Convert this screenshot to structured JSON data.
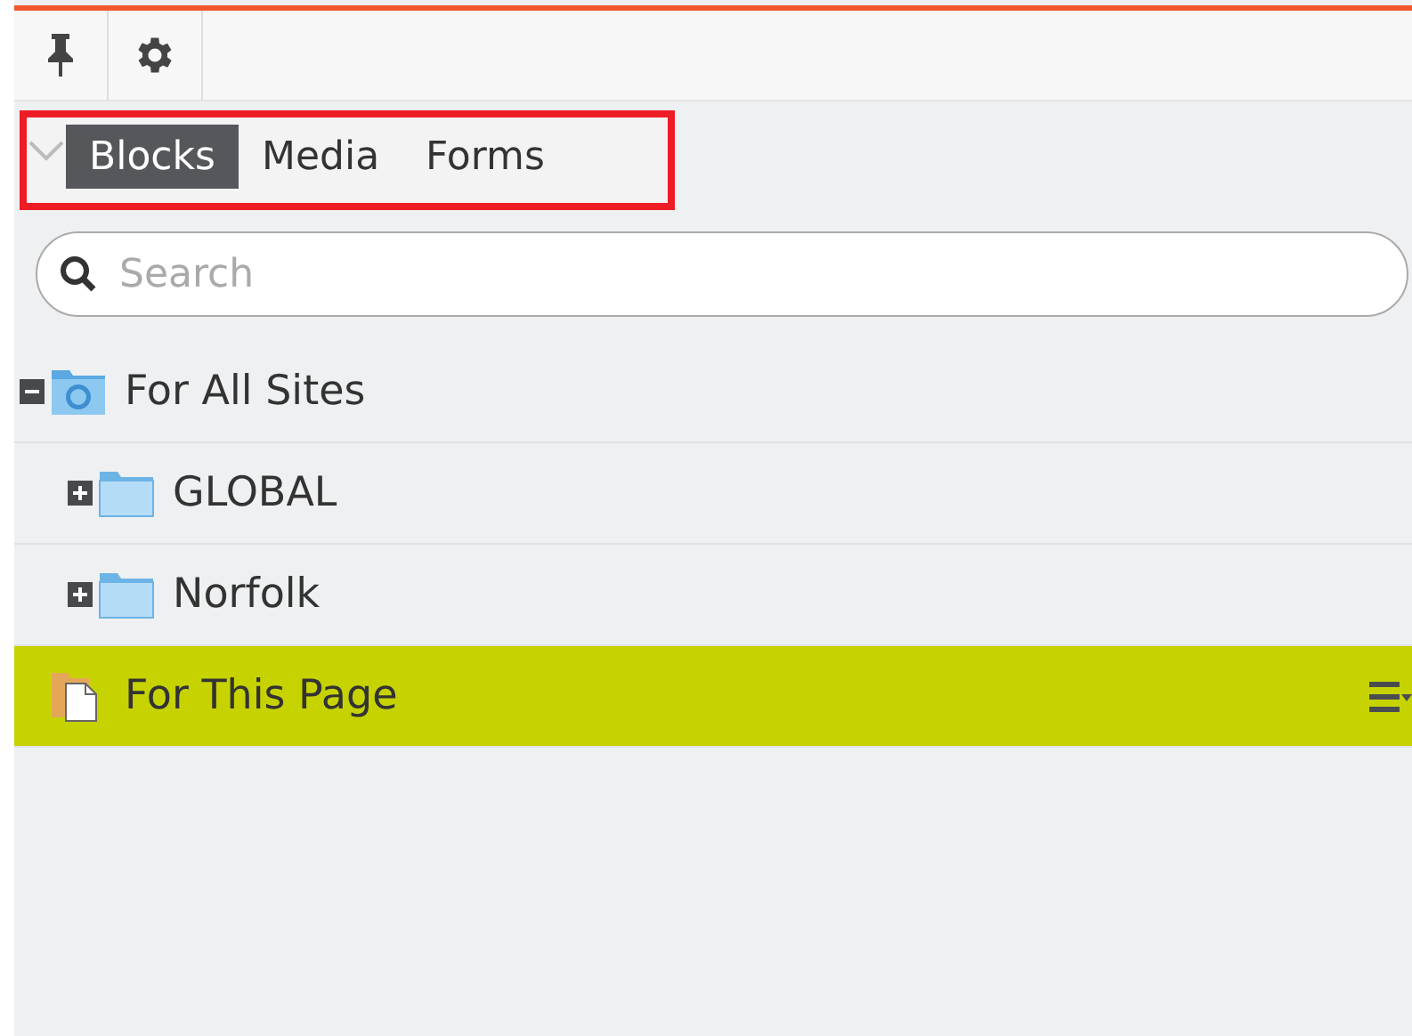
{
  "toolbar": {
    "buttons": [
      {
        "kind": "pin"
      },
      {
        "kind": "settings"
      }
    ]
  },
  "tabs": [
    {
      "label": "Blocks",
      "selected": true
    },
    {
      "label": "Media",
      "selected": false
    },
    {
      "label": "Forms",
      "selected": false
    }
  ],
  "search": {
    "placeholder": "Search"
  },
  "tree": [
    {
      "label": "For All Sites",
      "kind": "site",
      "expanded": true,
      "selected": false,
      "children": [
        {
          "label": "GLOBAL",
          "kind": "folder",
          "expanded": false,
          "selected": false
        },
        {
          "label": "Norfolk",
          "kind": "folder",
          "expanded": false,
          "selected": false
        }
      ]
    },
    {
      "label": "For This Page",
      "kind": "page",
      "selected": true
    }
  ]
}
